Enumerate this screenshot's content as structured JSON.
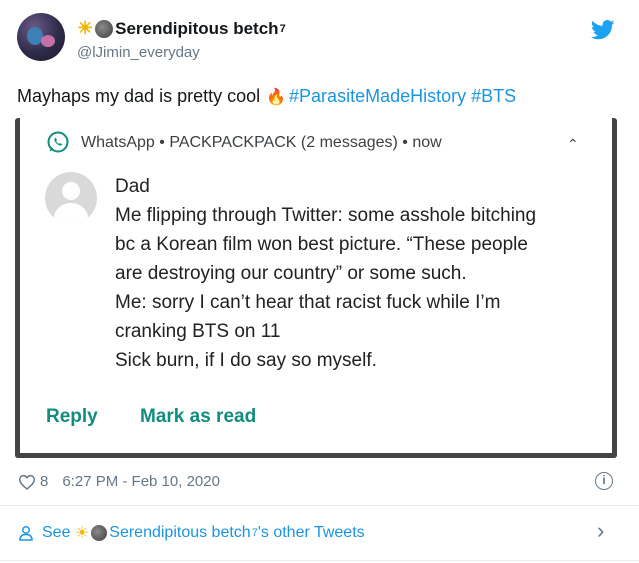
{
  "author": {
    "name": "Serendipitous betch",
    "name_sup": "7",
    "handle": "@lJimin_everyday"
  },
  "tweet": {
    "text": "Mayhaps my dad is pretty cool",
    "hashtags": [
      "#ParasiteMadeHistory",
      "#BTS"
    ]
  },
  "notification": {
    "app": "WhatsApp",
    "separator1": "•",
    "group": "PACKPACKPACK (2 messages)",
    "separator2": "•",
    "time": "now",
    "sender": "Dad",
    "lines": [
      "Me flipping through Twitter: some asshole bitching",
      "bc a Korean film won best picture. “These people",
      "are destroying our country” or some such.",
      "Me: sorry I can’t hear that racist fuck while I’m",
      "cranking BTS on 11",
      "Sick burn, if I do say so myself."
    ],
    "reply_label": "Reply",
    "mark_read_label": "Mark as read"
  },
  "meta": {
    "like_count": "8",
    "timestamp": "6:27 PM - Feb 10, 2020"
  },
  "footer": {
    "see_prefix": "See",
    "see_name": "Serendipitous betch",
    "see_sup": "7",
    "see_suffix": "'s other Tweets"
  },
  "colors": {
    "link": "#1b95e0",
    "whatsapp_green": "#128c7e",
    "muted": "#657786",
    "card_border": "#444444"
  }
}
